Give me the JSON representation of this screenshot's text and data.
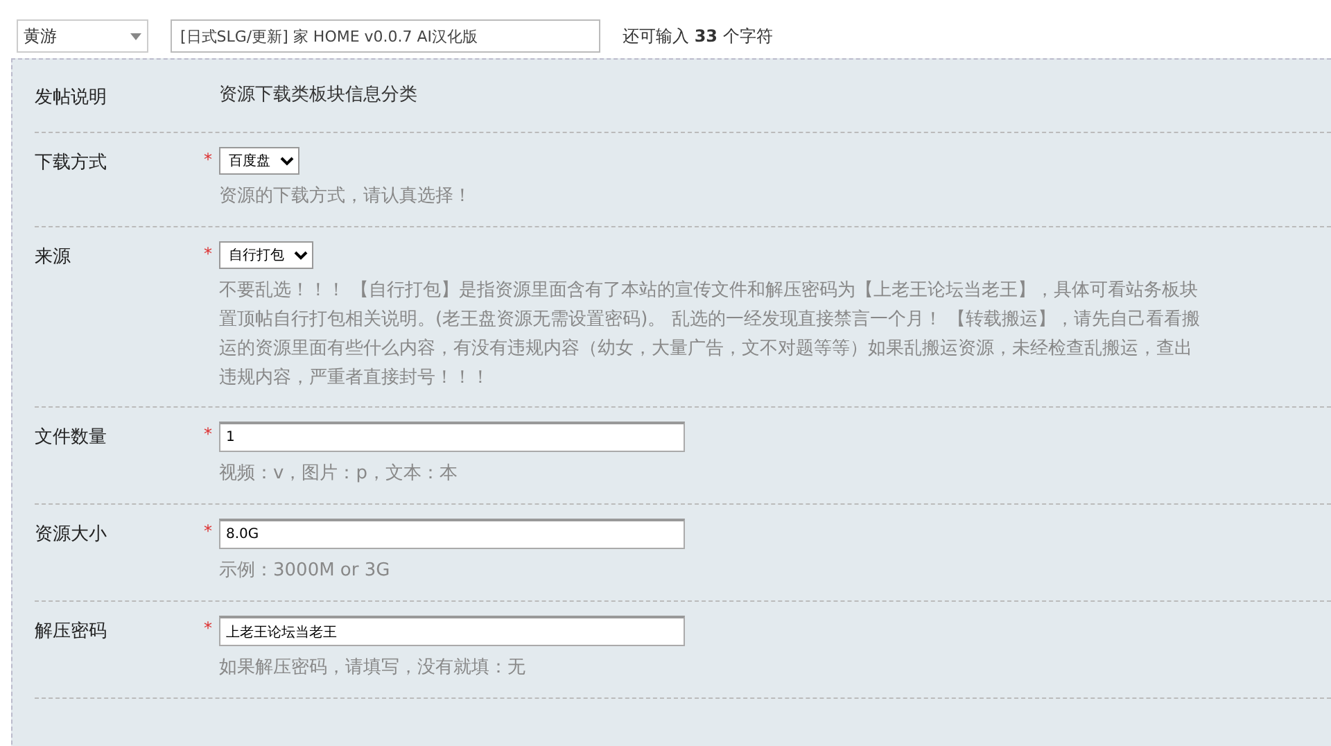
{
  "topbar": {
    "category": "黄游",
    "title_value": "[日式SLG/更新] 家 HOME v0.0.7 AI汉化版",
    "remaining_prefix": "还可输入",
    "remaining_count": "33",
    "remaining_suffix": "个字符"
  },
  "header": {
    "label": "发帖说明",
    "value": "资源下载类板块信息分类"
  },
  "fields": [
    {
      "kind": "select",
      "label": "下载方式",
      "required_mark": "*",
      "value": "百度盘",
      "hint_lines": [
        "资源的下载方式，请认真选择！"
      ]
    },
    {
      "kind": "select",
      "label": "来源",
      "required_mark": "*",
      "value": "自行打包",
      "hint_lines": [
        "不要乱选！！！ 【自行打包】是指资源里面含有了本站的宣传文件和解压密码为【上老王论坛当老王】，具体可看站务板块",
        "置顶帖自行打包相关说明。(老王盘资源无需设置密码)。 乱选的一经发现直接禁言一个月！ 【转载搬运】，请先自己看看搬",
        "运的资源里面有些什么内容，有没有违规内容（幼女，大量广告，文不对题等等）如果乱搬运资源，未经检查乱搬运，查出",
        "违规内容，严重者直接封号！！！"
      ]
    },
    {
      "kind": "text",
      "label": "文件数量",
      "required_mark": "*",
      "value": "1",
      "hint_lines": [
        "视频：v，图片：p，文本：本"
      ]
    },
    {
      "kind": "text",
      "label": "资源大小",
      "required_mark": "*",
      "value": "8.0G",
      "hint_lines": [
        "示例：3000M or 3G"
      ]
    },
    {
      "kind": "text",
      "label": "解压密码",
      "required_mark": "*",
      "value": "上老王论坛当老王",
      "hint_lines": [
        "如果解压密码，请填写，没有就填：无"
      ]
    }
  ]
}
